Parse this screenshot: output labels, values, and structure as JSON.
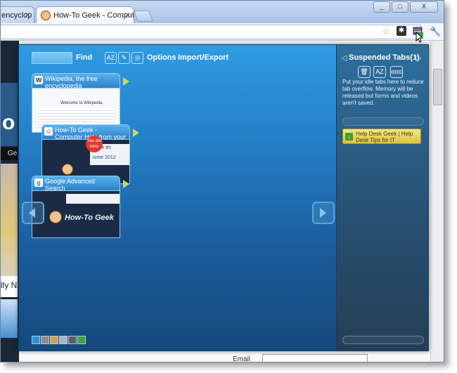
{
  "browser": {
    "tabs": [
      {
        "label": "encyclop",
        "active": false
      },
      {
        "label": "How-To Geek - Computer H",
        "active": true
      }
    ],
    "window_buttons": [
      "_",
      "□",
      "X"
    ]
  },
  "page": {
    "email_label": "Email"
  },
  "extension": {
    "find_label": "Find",
    "options_label": "Options",
    "import_export_label": "Import/Export",
    "tool_icons": [
      "sort-az-icon",
      "edit-icon",
      "chrome-icon"
    ],
    "cards": [
      {
        "title": "Wikipedia, the free encyclopedia",
        "favicon": "W",
        "thumb_heading": "Welcome to Wikipedia,"
      },
      {
        "title": "How-To Geek - Computer Help from your Friendly",
        "favicon": "☺",
        "thumb_bubble": "You are here",
        "thumb_text": "True Im",
        "thumb_date": "iume 2012"
      },
      {
        "title": "Google Advanced Search",
        "favicon": "g",
        "thumb_logo": "How-To Geek"
      }
    ],
    "swatch_colors": [
      "#2d8fd6",
      "#8c8c8c",
      "#caa44a",
      "#a8b4c4",
      "#555e6a",
      "#3aa33a"
    ],
    "suspended": {
      "title": "Suspended Tabs(1)",
      "description": "Put your idle tabs here to reduce tab overflow. Memory will be released but forms and videos aren't saved.",
      "icons": [
        "trash-icon",
        "sort-az-icon",
        "ooo-icon"
      ],
      "item_label": "Help Desk Geek | Help Desk Tips for IT"
    }
  },
  "background_fragments": {
    "letter": "o",
    "word1": "Ge",
    "word2": "lly N"
  }
}
